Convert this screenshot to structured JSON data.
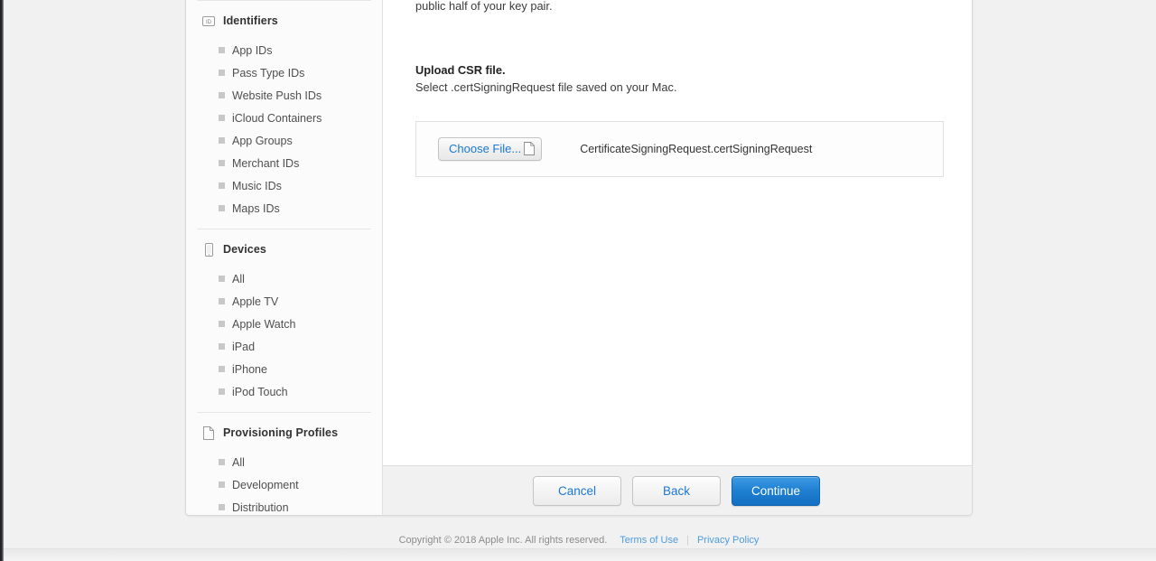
{
  "sidebar": {
    "groups": [
      {
        "id": "identifiers",
        "title": "Identifiers",
        "icon": "id-badge-icon",
        "items": [
          {
            "label": "App IDs"
          },
          {
            "label": "Pass Type IDs"
          },
          {
            "label": "Website Push IDs"
          },
          {
            "label": "iCloud Containers"
          },
          {
            "label": "App Groups"
          },
          {
            "label": "Merchant IDs"
          },
          {
            "label": "Music IDs"
          },
          {
            "label": "Maps IDs"
          }
        ]
      },
      {
        "id": "devices",
        "title": "Devices",
        "icon": "iphone-icon",
        "items": [
          {
            "label": "All"
          },
          {
            "label": "Apple TV"
          },
          {
            "label": "Apple Watch"
          },
          {
            "label": "iPad"
          },
          {
            "label": "iPhone"
          },
          {
            "label": "iPod Touch"
          }
        ]
      },
      {
        "id": "provisioning-profiles",
        "title": "Provisioning Profiles",
        "icon": "document-icon",
        "items": [
          {
            "label": "All"
          },
          {
            "label": "Development"
          },
          {
            "label": "Distribution"
          }
        ]
      }
    ]
  },
  "main": {
    "intro_paragraph": "is stored on your computer. On a Mac, it is stored in the login Keychain by default and can be viewed in the Keychain Access app under the \"Keys\" category. Your requested certificate is the public half of your key pair.",
    "upload_heading": "Upload CSR file.",
    "upload_subheading": "Select .certSigningRequest file saved on your Mac.",
    "choose_file_label": "Choose File...",
    "selected_file_name": "CertificateSigningRequest.certSigningRequest"
  },
  "buttons": {
    "cancel_label": "Cancel",
    "back_label": "Back",
    "continue_label": "Continue"
  },
  "footer": {
    "copyright": "Copyright © 2018 Apple Inc. All rights reserved.",
    "terms_label": "Terms of Use",
    "separator": "|",
    "privacy_label": "Privacy Policy"
  },
  "colors": {
    "accent_blue": "#1b78d4",
    "primary_button": "#1f80d2",
    "link_blue": "#4d9ce0",
    "page_background": "#f1f1f1",
    "panel_background": "#ffffff"
  }
}
